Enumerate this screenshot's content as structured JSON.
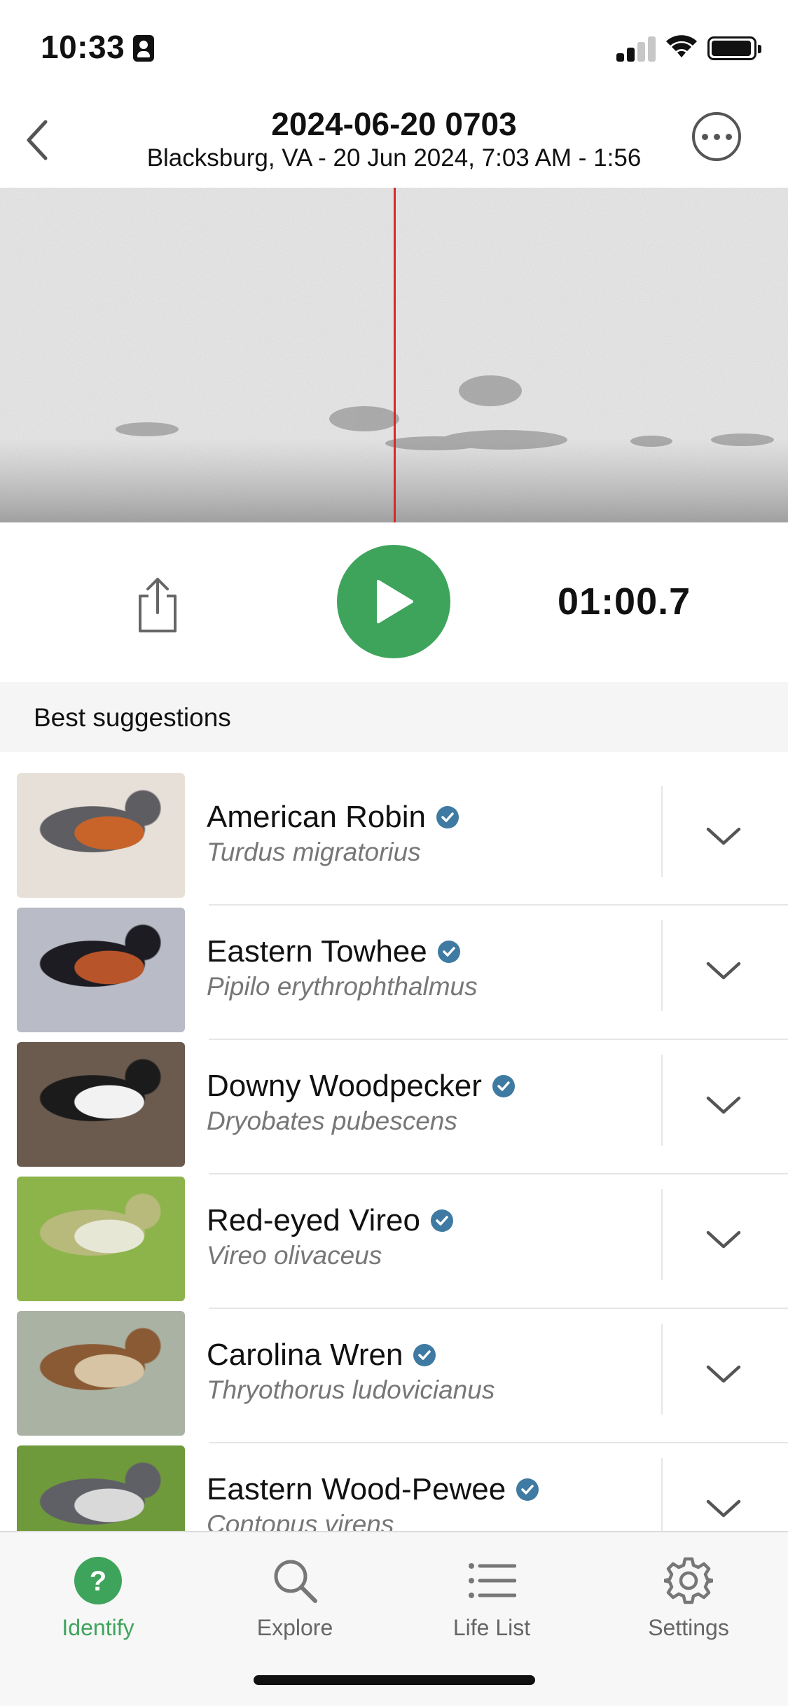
{
  "status_bar": {
    "time": "10:33"
  },
  "header": {
    "title": "2024-06-20 0703",
    "subtitle": "Blacksburg, VA - 20 Jun 2024, 7:03 AM - 1:56"
  },
  "player": {
    "elapsed": "01:00.7",
    "progress_fraction": 0.535
  },
  "section": {
    "title": "Best suggestions"
  },
  "suggestions": [
    {
      "common": "American Robin",
      "scientific": "Turdus migratorius",
      "photo_colors": [
        "#e6e0d8",
        "#5d5d62",
        "#c8632a"
      ]
    },
    {
      "common": "Eastern Towhee",
      "scientific": "Pipilo erythrophthalmus",
      "photo_colors": [
        "#b9bcc6",
        "#1c1c22",
        "#b8542a"
      ]
    },
    {
      "common": "Downy Woodpecker",
      "scientific": "Dryobates pubescens",
      "photo_colors": [
        "#6b5a4e",
        "#1b1b1b",
        "#f2f2f2"
      ]
    },
    {
      "common": "Red-eyed Vireo",
      "scientific": "Vireo olivaceus",
      "photo_colors": [
        "#8db44a",
        "#b8ba7c",
        "#e7e7d6"
      ]
    },
    {
      "common": "Carolina Wren",
      "scientific": "Thryothorus ludovicianus",
      "photo_colors": [
        "#aab2a4",
        "#8a5a34",
        "#d6c4a4"
      ]
    },
    {
      "common": "Eastern Wood-Pewee",
      "scientific": "Contopus virens",
      "photo_colors": [
        "#6f9a3c",
        "#5f5f66",
        "#d9d9d9"
      ]
    }
  ],
  "tabs": [
    {
      "label": "Identify",
      "icon": "question-circle-icon",
      "active": true
    },
    {
      "label": "Explore",
      "icon": "search-icon",
      "active": false
    },
    {
      "label": "Life List",
      "icon": "list-icon",
      "active": false
    },
    {
      "label": "Settings",
      "icon": "gear-icon",
      "active": false
    }
  ],
  "colors": {
    "accent": "#3ea45b",
    "playhead": "#d62828",
    "verified_badge": "#3e7aa1"
  }
}
